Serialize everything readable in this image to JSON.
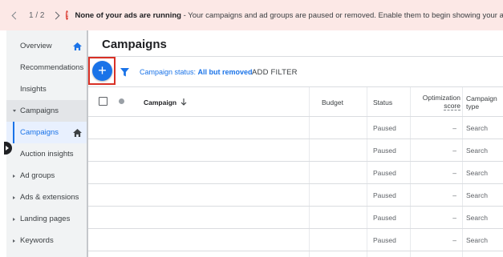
{
  "banner": {
    "pager": "1 / 2",
    "alert_icon": "!",
    "alert_title": "None of your ads are running",
    "alert_body": " - Your campaigns and ad groups are paused or removed. Enable them to begin showing your ads."
  },
  "sidebar": {
    "items": [
      {
        "label": "Overview"
      },
      {
        "label": "Recommendations"
      },
      {
        "label": "Insights"
      },
      {
        "label": "Campaigns"
      },
      {
        "label": "Campaigns"
      },
      {
        "label": "Auction insights"
      },
      {
        "label": "Ad groups"
      },
      {
        "label": "Ads & extensions"
      },
      {
        "label": "Landing pages"
      },
      {
        "label": "Keywords"
      }
    ]
  },
  "main": {
    "title": "Campaigns",
    "add_icon": "+",
    "filter_prefix": "Campaign status: ",
    "filter_value": "All but removed",
    "add_filter": "ADD FILTER"
  },
  "table": {
    "headers": {
      "campaign": "Campaign",
      "budget": "Budget",
      "status": "Status",
      "opt_line1": "Optimization",
      "opt_line2": "score",
      "type_line1": "Campaign",
      "type_line2": "type"
    },
    "rows": [
      {
        "status": "Paused",
        "opt": "–",
        "type": "Search"
      },
      {
        "status": "Paused",
        "opt": "–",
        "type": "Search"
      },
      {
        "status": "Paused",
        "opt": "–",
        "type": "Search"
      },
      {
        "status": "Paused",
        "opt": "–",
        "type": "Search"
      },
      {
        "status": "Paused",
        "opt": "–",
        "type": "Search"
      },
      {
        "status": "Paused",
        "opt": "–",
        "type": "Search"
      }
    ]
  },
  "colors": {
    "accent": "#1a73e8",
    "alert": "#d93025",
    "banner_bg": "#fce8e6",
    "sidebar_bg": "#f1f3f4"
  },
  "icons": {
    "prev": "chevron-left-icon",
    "next": "chevron-right-icon",
    "alert": "alert-icon",
    "home": "home-icon",
    "filter": "filter-icon",
    "sort": "arrow-down-icon",
    "add": "plus-icon"
  }
}
